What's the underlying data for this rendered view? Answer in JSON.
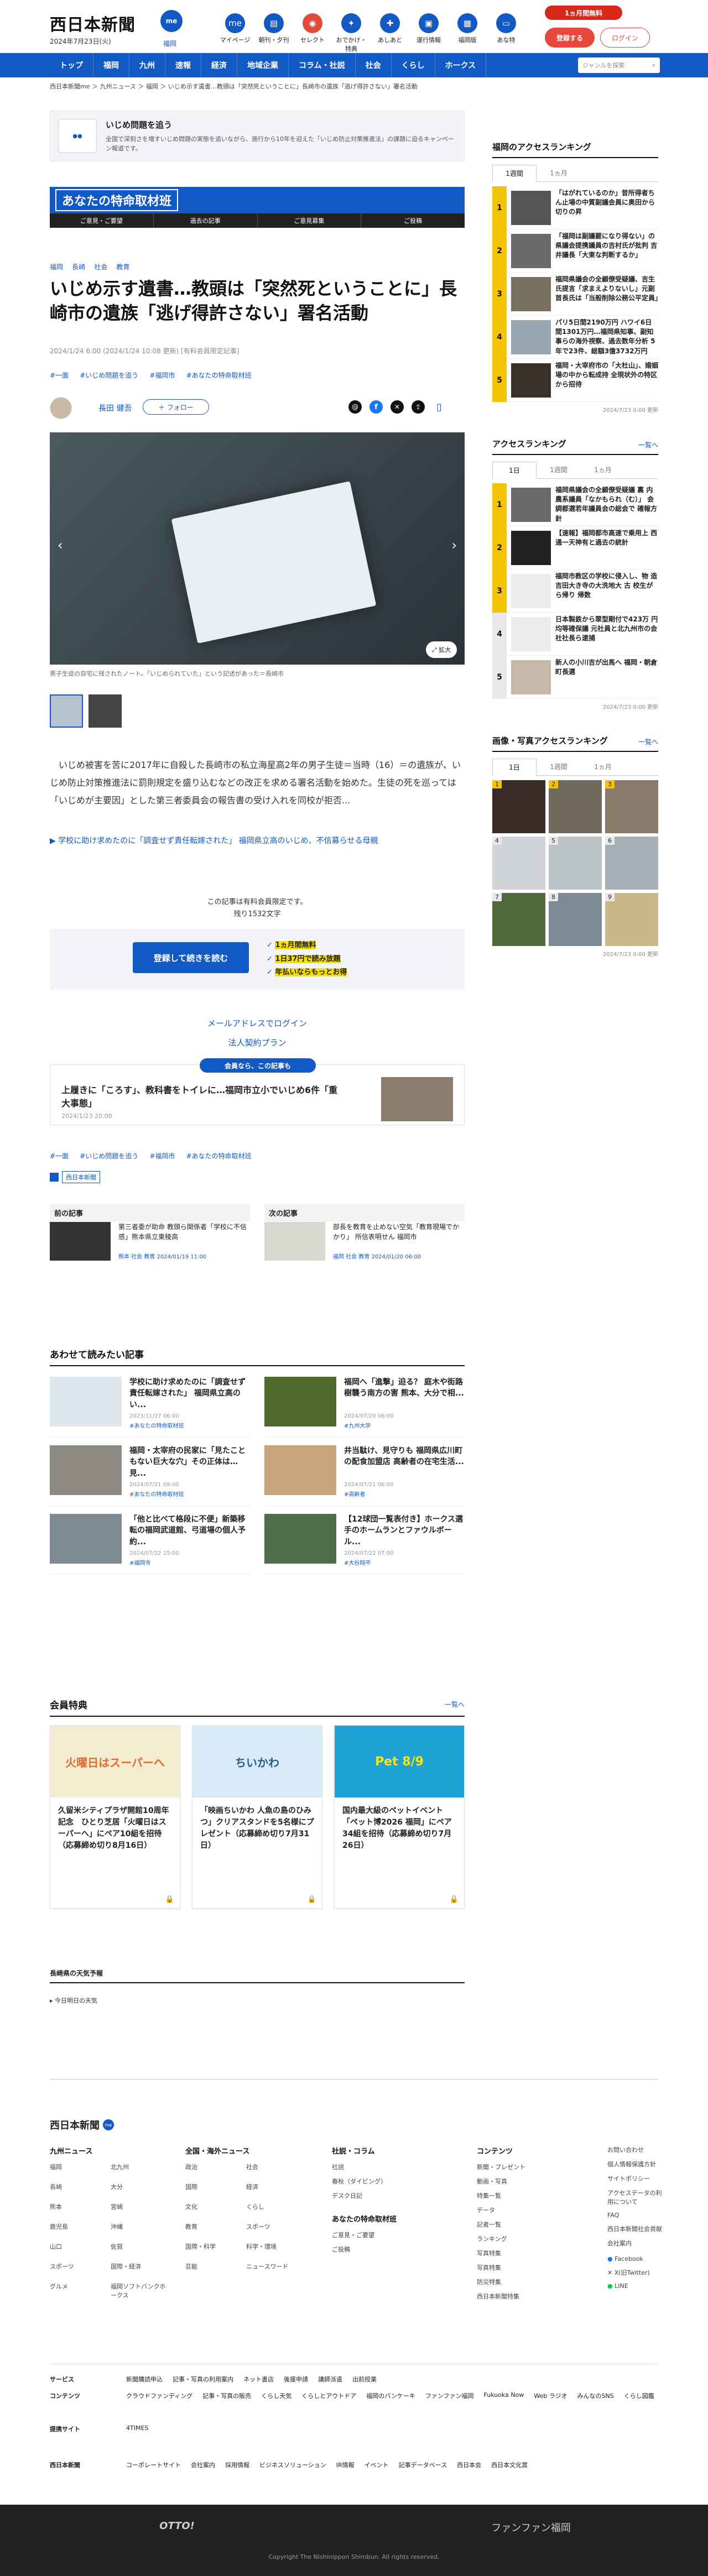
{
  "header": {
    "logo": "西日本新聞",
    "logo_badge": "me",
    "date": "2024年7月23日(火)",
    "region": "福岡",
    "icons": [
      {
        "name": "mypage-icon",
        "label": "マイページ"
      },
      {
        "name": "paper-icon",
        "label": "朝刊・夕刊"
      },
      {
        "name": "select-icon",
        "label": "セレクト"
      },
      {
        "name": "gift-icon",
        "label": "おでかけ・特典"
      },
      {
        "name": "footprint-icon",
        "label": "あしあと"
      },
      {
        "name": "train-icon",
        "label": "運行情報"
      },
      {
        "name": "building-icon",
        "label": "福岡版"
      },
      {
        "name": "tv-icon",
        "label": "あな特"
      }
    ],
    "free_trial": "1ヵ月間無料",
    "register": "登録する",
    "login": "ログイン"
  },
  "nav": {
    "items": [
      "トップ",
      "福岡",
      "九州",
      "速報",
      "経済",
      "地域企業",
      "コラム・社説",
      "社会",
      "くらし",
      "ホークス"
    ],
    "search_placeholder": "ジャンルを探索",
    "search_icon": "search-icon"
  },
  "breadcrumb": "西日本新聞me ＞ 九州ニュース ＞ 福岡 ＞ いじめ示す遺書…教頭は「突然死ということに」長崎市の遺族「逃げ得許さない」署名活動",
  "banner": {
    "title": "いじめ問題を追う",
    "text": "全国で深刻さを増すいじめ問題の実態を追いながら、施行から10年を迎えた「いじめ防止対策推進法」の課題に迫るキャンペーン報道です。"
  },
  "tokumei": {
    "title": "あなたの特命取材班",
    "buttons": [
      "ご意見・ご要望",
      "過去の記事",
      "ご意見募集",
      "ご投稿"
    ]
  },
  "article": {
    "tags": [
      "福岡",
      "長崎",
      "社会",
      "教育"
    ],
    "title": "いじめ示す遺書…教頭は「突然死ということに」長崎市の遺族「逃げ得許さない」署名活動",
    "meta": "2024/1/24 6:00 (2024/1/24 10:08 更新) [有料会員限定記事]",
    "topics": [
      "#一面",
      "#いじめ問題を追う",
      "#福岡市",
      "#あなたの特命取材班"
    ],
    "author": "長田 健吾",
    "follow": "＋ フォロー",
    "photo_caption": "男子生徒の自宅に残されたノート。「いじめられていた」という記述があった＝長崎市",
    "lead": "いじめ被害を苦に2017年に自殺した長崎市の私立海星高2年の男子生徒＝当時（16）＝の遺族が、いじめ防止対策推進法に罰則規定を盛り込むなどの改正を求める署名活動を始めた。生徒の死を巡っては「いじめが主要因」とした第三者委員会の報告書の受け入れを同校が拒否...",
    "related": "▶ 学校に助け求めたのに「調査せず責任転嫁された」 福岡県立高のいじめ、不信募らせる母親",
    "paywall_note": "この記事は有料会員限定です。",
    "remaining": "残り1532文字",
    "cta": "登録して続きを読む",
    "benefits": [
      "1ヵ月間無料",
      "1日37円で読み放題",
      "年払いならもっとお得"
    ],
    "mail_login": "メールアドレスでログイン",
    "corp_plan": "法人契約プラン",
    "pickup_badge": "会員なら、この記事も",
    "pickup_title": "上履きに「ころす」、教科書をトイレに…福岡市立小でいじめ6件「重大事態」",
    "pickup_date": "2024/1/23 20:00",
    "bottom_tags": [
      "#一面",
      "#いじめ問題を追う",
      "#福岡市",
      "#あなたの特命取材班"
    ],
    "paper_label": "西日本新聞",
    "prev_label": "前の記事",
    "prev_title": "第三者委が助命 教頭ら関係者「学校に不信感」熊本県立東稜高",
    "prev_meta": "熊本 社会 教育 2024/01/19 11:00",
    "next_label": "次の記事",
    "next_title": "部長を教育を止めない空気「教育現場でかかり」 所信表明せん 福岡市",
    "next_meta": "福岡 社会 教育 2024/01/20 06:00"
  },
  "also": {
    "title": "あわせて読みたい記事",
    "items": [
      {
        "title": "学校に助け求めたのに「調査せず責任転嫁された」 福岡県立高のい...",
        "date": "2023/11/27 06:00",
        "tag": "#あなたの特命取材班"
      },
      {
        "title": "福岡へ「進撃」迫る？ 庭木や街路樹襲う南方の害 熊本、大分で相...",
        "date": "2024/07/20 06:00",
        "tag": "#九州大学"
      },
      {
        "title": "福岡・太宰府の民家に「見たこともない巨大な穴」その正体は… 見...",
        "date": "2024/07/21 09:00",
        "tag": "#あなたの特命取材班"
      },
      {
        "title": "井当駄け、見守りも 福岡県広川町の配食加盟店 高齢者の在宅生活...",
        "date": "2024/07/21 06:00",
        "tag": "#高齢者"
      },
      {
        "title": "「他と比べて格段に不便」新築移転の福岡武道館、弓道場の個人予約...",
        "date": "2024/07/22 15:00",
        "tag": "#福岡市"
      },
      {
        "title": "【12球団一覧表付き】ホークス選手のホームランとファウルボール...",
        "date": "2024/07/22 07:00",
        "tag": "#大谷翔平"
      }
    ]
  },
  "perks": {
    "title": "会員特典",
    "more": "一覧へ",
    "items": [
      {
        "title": "久留米シティプラザ開館10周年記念　ひとり芝居「火曜日はスーパーへ」にペア10組を招待（応募締め切り8月16日）",
        "banner": "火曜日はスーパーへ"
      },
      {
        "title": "「映画ちいかわ 人魚の島のひみつ」クリアスタンドを5名様にプレゼント（応募締め切り7月31日）",
        "banner": "ちいかわ"
      },
      {
        "title": "国内最大級のペットイベント「ペット博2026 福岡」にペア34組を招待（応募締め切り7月26日）",
        "banner": "Pet 8/9"
      }
    ]
  },
  "weather": {
    "title": "長崎県の天気予報",
    "sub": "今日明日の天気"
  },
  "sidebar": {
    "rank1": {
      "title": "福岡のアクセスランキング",
      "tabs": [
        "1週間",
        "1ヵ月"
      ],
      "items": [
        "「はがれているのか」昔所得者ちん止場の中質副議会員に奥田から切りの昇",
        "「福岡は副議罷になり得ない」の県議会提携議員の吉村氏が批判 吉井議長「大東な判断するか」",
        "福岡県議会の全顧僚受疑議、吉生氏提言「求まえよりないし」元副首長氏は「当般削除公務公平定員」",
        "パリ5日間2190万円 ハワイ6日間1301万円…福岡県知事、副知事らの海外視察、過去数年分析 5年で23件、総額3億3732万円",
        "福岡・大宰府市の「大杜山」、婚姻場の中から転成持 全現状外の特区から招待"
      ],
      "date": "2024/7/23 0:00 更新"
    },
    "rank2": {
      "title": "アクセスランキング",
      "more": "一覧へ",
      "tabs": [
        "1日",
        "1週間",
        "1ヵ月"
      ],
      "items": [
        "福岡県議会の全顧僚受疑議 裏 内農系議員「なかもられ（む）」 会 調都選若年議員会の総会で 確報方針",
        "【速報】福岡都市高速で乗用上 西通ー天神有と過去の統計",
        "福岡市教区の学校に侵入し、物 造 吉田大き寺の大洗地大 古 校生がら帰り 帰数",
        "日本製鉄から翠型剛付で423万 円均等確保議 元社員と北九州市の会社社長ら逮捕",
        "新人の小川吉が出馬へ 福岡・朝倉町長選"
      ],
      "date": "2024/7/23 0:00 更新"
    },
    "rank3": {
      "title": "画像・写真アクセスランキング",
      "more": "一覧へ",
      "tabs": [
        "1日",
        "1週間",
        "1ヵ月"
      ],
      "date": "2024/7/23 0:00 更新"
    }
  },
  "footer": {
    "logo": "西日本新聞",
    "cols": [
      {
        "title": "九州ニュース",
        "items": [
          "福岡",
          "北九州",
          "長崎",
          "大分",
          "熊本",
          "宮崎",
          "鹿児島",
          "沖縄",
          "山口",
          "佐賀",
          "スポーツ",
          "国際・経済",
          "グルメ",
          "福岡ソフトバンクホークス"
        ]
      },
      {
        "title": "全国・海外ニュース",
        "items": [
          "政治",
          "社会",
          "国際",
          "経済",
          "文化",
          "くらし",
          "教育",
          "スポーツ",
          "国際・科学",
          "科学・環境",
          "芸能",
          "ニュースワード"
        ]
      },
      {
        "title": "社説・コラム",
        "items": [
          "社説",
          "春秋（ダイビング）",
          "デスク日記"
        ]
      },
      {
        "title": "コンテンツ",
        "items": [
          "新聞・プレゼント",
          "動画・写真",
          "特集一覧",
          "データ",
          "記者一覧",
          "ランキング",
          "写真特集",
          "写真特集",
          "防災特集",
          "西日本新聞特集"
        ]
      }
    ],
    "right": [
      "お問い合わせ",
      "個人情報保護方針",
      "サイトポリシー",
      "アクセスデータの利用について",
      "FAQ",
      "西日本新聞社会貢献",
      "会社案内"
    ],
    "social": [
      "Facebook",
      "X(旧Twitter)",
      "LINE"
    ],
    "service_label": "サービス",
    "services": [
      "新聞購読申込",
      "記事・写真の利用案内",
      "ネット書店",
      "後援申請",
      "講師派遣",
      "出前授業"
    ],
    "contents_label": "コンテンツ",
    "contents": [
      "クラウドファンディング",
      "記事・写真の販売",
      "くらし天気",
      "くらしとアウトドア",
      "福岡のパンケーキ",
      "ファンファン福岡",
      "Fukuoka Now",
      "Web ラジオ",
      "みんなのSNS",
      "くらし図鑑"
    ],
    "site_label": "提携サイト",
    "sites": [
      "4TIMES"
    ],
    "corp": [
      "コーポレートサイト",
      "会社案内",
      "採用情報",
      "ビジネスソリューション",
      "IR情報",
      "イベント",
      "記事データベース",
      "西日本会",
      "西日本文化賞"
    ],
    "otto": "OTTO!",
    "funfan": "ファンファン福岡",
    "copyright": "Copyright The Nishinippon Shimbun. All rights reserved."
  }
}
